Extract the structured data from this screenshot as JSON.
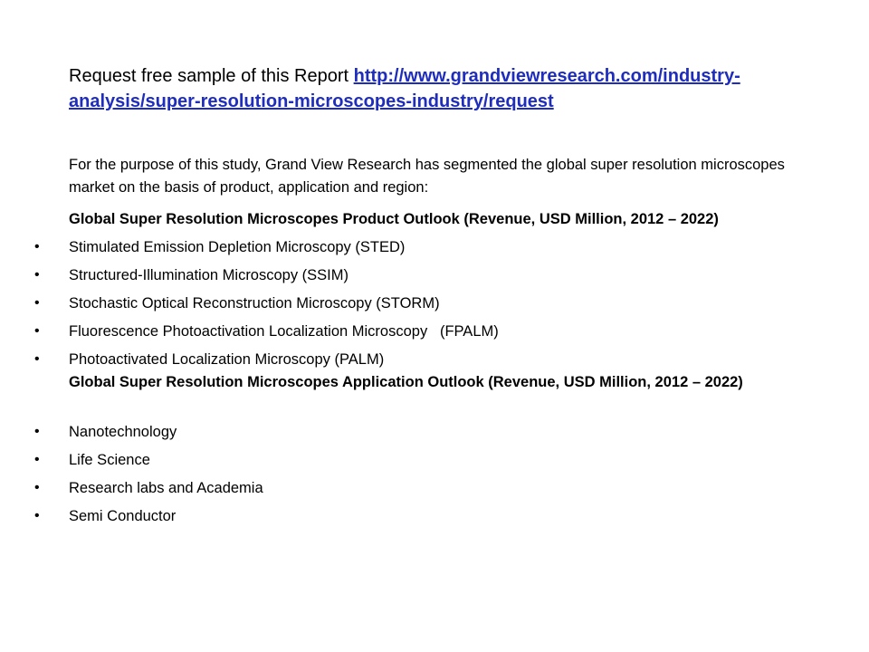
{
  "request": {
    "prefix": "Request free sample of this Report ",
    "link_text": "http://www.grandviewresearch.com/industry-analysis/super-resolution-microscopes-industry/request"
  },
  "intro": "For the purpose of this study, Grand View Research has segmented the global super resolution microscopes market on the basis of product, application and region:",
  "product_outlook": {
    "heading": "Global Super Resolution Microscopes Product Outlook (Revenue, USD Million, 2012 – 2022)",
    "items": [
      "Stimulated Emission Depletion Microscopy (STED)",
      "Structured-Illumination Microscopy (SSIM)",
      "Stochastic Optical Reconstruction Microscopy (STORM)",
      "Fluorescence Photoactivation Localization Microscopy   (FPALM)",
      "Photoactivated Localization Microscopy (PALM)"
    ]
  },
  "application_outlook": {
    "heading": "Global Super Resolution Microscopes Application Outlook (Revenue, USD Million, 2012 – 2022)",
    "items": [
      "Nanotechnology",
      "Life Science",
      "Research labs and Academia",
      "Semi Conductor"
    ]
  },
  "colors": {
    "link": "#1f2dbd",
    "text": "#000000",
    "background": "#ffffff"
  }
}
